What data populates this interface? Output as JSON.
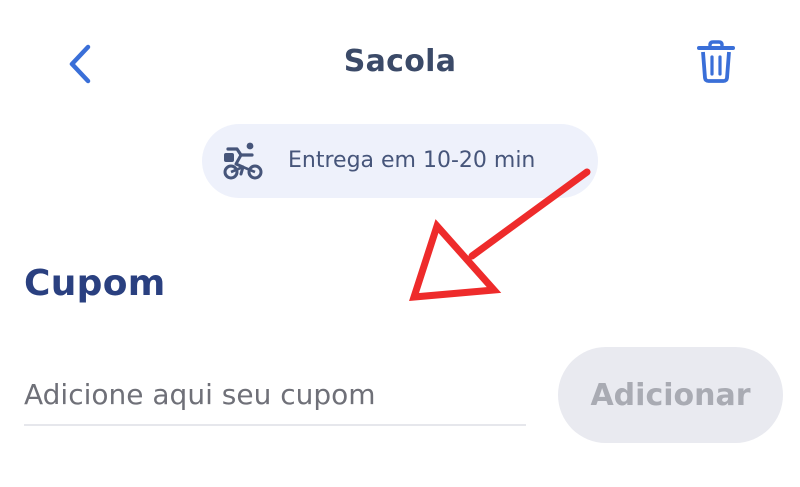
{
  "header": {
    "title": "Sacola",
    "back_icon": "chevron-left-icon",
    "trash_icon": "trash-icon"
  },
  "delivery": {
    "icon": "bicycle-delivery-icon",
    "text": "Entrega em 10-20 min"
  },
  "coupon": {
    "heading": "Cupom",
    "input_value": "",
    "input_placeholder": "Adicione aqui seu cupom",
    "add_label": "Adicionar"
  },
  "colors": {
    "accent_blue": "#3a6fd8",
    "heading_blue": "#2a4080",
    "title_gray": "#3b4a68",
    "pill_background": "#eef1fb",
    "button_disabled_background": "#e9eaf0",
    "button_disabled_text": "#a9abb3",
    "annotation_red": "#ee2b2b"
  },
  "annotation": {
    "icon": "red-arrow-icon"
  }
}
